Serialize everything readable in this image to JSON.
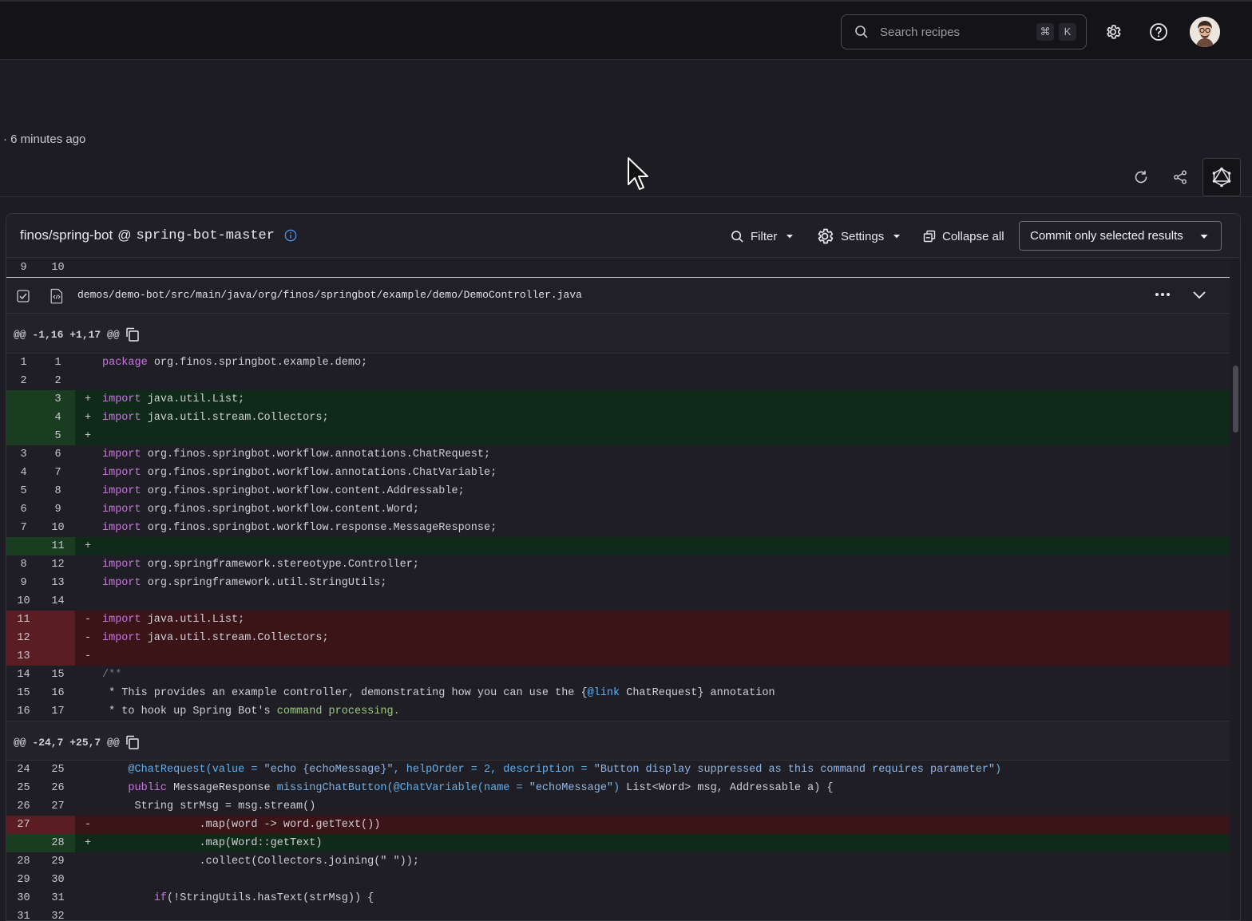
{
  "topbar": {
    "search_placeholder": "Search recipes",
    "shortcut_keys": [
      "⌘",
      "K"
    ],
    "icons": [
      "search-icon",
      "gear-icon",
      "help-icon",
      "avatar"
    ]
  },
  "meta": {
    "time_ago": "· 6 minutes ago"
  },
  "panel": {
    "repo": "finos/spring-bot",
    "at": "@",
    "branch": "spring-bot-master",
    "filter_label": "Filter",
    "settings_label": "Settings",
    "collapse_label": "Collapse all",
    "commit_label": "Commit only selected results"
  },
  "prev_row": {
    "old": "9",
    "new": "10"
  },
  "file": {
    "path": "demos/demo-bot/src/main/java/org/finos/springbot/example/demo/DemoController.java"
  },
  "hunk1": {
    "header": "@@ -1,16 +1,17 @@"
  },
  "hunk2": {
    "header": "@@ -24,7 +25,7 @@"
  },
  "hunk1_rows": [
    {
      "o": "1",
      "n": "1",
      "t": "ctx",
      "s": "",
      "k": "package",
      "r": " org.finos.springbot.example.demo;"
    },
    {
      "o": "2",
      "n": "2",
      "t": "ctx",
      "s": "",
      "k": "",
      "r": ""
    },
    {
      "o": "",
      "n": "3",
      "t": "add",
      "s": "+",
      "k": "import",
      "r": " java.util.List;"
    },
    {
      "o": "",
      "n": "4",
      "t": "add",
      "s": "+",
      "k": "import",
      "r": " java.util.stream.Collectors;"
    },
    {
      "o": "",
      "n": "5",
      "t": "add",
      "s": "+",
      "k": "",
      "r": ""
    },
    {
      "o": "3",
      "n": "6",
      "t": "ctx",
      "s": "",
      "k": "import",
      "r": " org.finos.springbot.workflow.annotations.ChatRequest;"
    },
    {
      "o": "4",
      "n": "7",
      "t": "ctx",
      "s": "",
      "k": "import",
      "r": " org.finos.springbot.workflow.annotations.ChatVariable;"
    },
    {
      "o": "5",
      "n": "8",
      "t": "ctx",
      "s": "",
      "k": "import",
      "r": " org.finos.springbot.workflow.content.Addressable;"
    },
    {
      "o": "6",
      "n": "9",
      "t": "ctx",
      "s": "",
      "k": "import",
      "r": " org.finos.springbot.workflow.content.Word;"
    },
    {
      "o": "7",
      "n": "10",
      "t": "ctx",
      "s": "",
      "k": "import",
      "r": " org.finos.springbot.workflow.response.MessageResponse;"
    },
    {
      "o": "",
      "n": "11",
      "t": "add",
      "s": "+",
      "k": "",
      "r": ""
    },
    {
      "o": "8",
      "n": "12",
      "t": "ctx",
      "s": "",
      "k": "import",
      "r": " org.springframework.stereotype.Controller;"
    },
    {
      "o": "9",
      "n": "13",
      "t": "ctx",
      "s": "",
      "k": "import",
      "r": " org.springframework.util.StringUtils;"
    },
    {
      "o": "10",
      "n": "14",
      "t": "ctx",
      "s": "",
      "k": "",
      "r": ""
    },
    {
      "o": "11",
      "n": "",
      "t": "del",
      "s": "-",
      "k": "import",
      "r": " java.util.List;"
    },
    {
      "o": "12",
      "n": "",
      "t": "del",
      "s": "-",
      "k": "import",
      "r": " java.util.stream.Collectors;"
    },
    {
      "o": "13",
      "n": "",
      "t": "del",
      "s": "-",
      "k": "",
      "r": ""
    }
  ],
  "hunk1_doc": [
    {
      "o": "14",
      "n": "15",
      "c": "/**"
    },
    {
      "o": "15",
      "n": "16",
      "a": " * This provides an example controller, demonstrating how you can use the {",
      "b": "@link",
      "d": " ChatRequest} annotation"
    },
    {
      "o": "16",
      "n": "17",
      "a": " * to hook up Spring Bot's ",
      "g": "command processing."
    }
  ],
  "hunk2_rows": [
    {
      "o": "24",
      "n": "25",
      "t": "ctx",
      "s": "",
      "html": "annot"
    },
    {
      "o": "25",
      "n": "26",
      "t": "ctx",
      "s": "",
      "html": "sig"
    },
    {
      "o": "26",
      "n": "27",
      "t": "ctx",
      "s": "",
      "r": "     String strMsg = msg.stream()"
    },
    {
      "o": "27",
      "n": "",
      "t": "del",
      "s": "-",
      "r": "               .map(word -> word.getText())"
    },
    {
      "o": "",
      "n": "28",
      "t": "add",
      "s": "+",
      "r": "               .map(Word::getText)"
    },
    {
      "o": "28",
      "n": "29",
      "t": "ctx",
      "s": "",
      "r": "               .collect(Collectors.joining(\" \"));"
    },
    {
      "o": "29",
      "n": "30",
      "t": "ctx",
      "s": "",
      "r": ""
    },
    {
      "o": "30",
      "n": "31",
      "t": "ctx",
      "s": "",
      "html": "if"
    },
    {
      "o": "31",
      "n": "32",
      "t": "ctx",
      "s": "",
      "r": ""
    }
  ],
  "annot_line": {
    "pre": "    ",
    "ann": "@ChatRequest(value = ",
    "str1": "\"echo {echoMessage}\"",
    "mid1": ", helpOrder = 2, description = ",
    "str2": "\"Button display suppressed as this command requires parameter\"",
    "end": ")"
  },
  "sig_line": {
    "pre": "    ",
    "kw": "public",
    "t1": " MessageResponse ",
    "fn": "missingChatButton",
    "an": "(@ChatVariable(name = ",
    "str": "\"echoMessage\"",
    "t2": ")",
    "rest": " List<Word> msg, Addressable a) {"
  },
  "if_line": {
    "pre": "        ",
    "kw": "if",
    "rest": "(!StringUtils.hasText(strMsg)) {"
  }
}
